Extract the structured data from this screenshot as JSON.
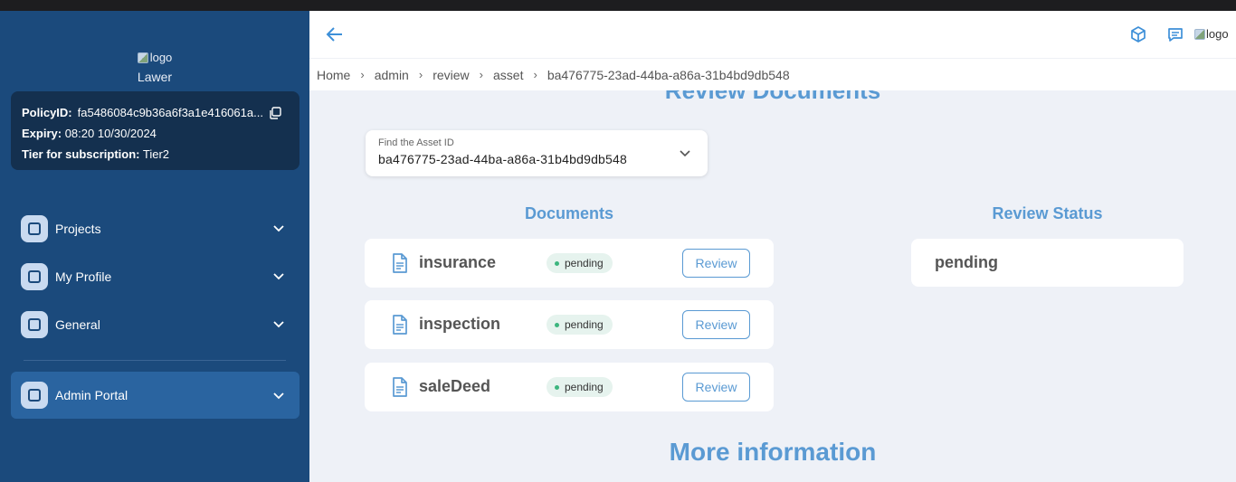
{
  "sidebar": {
    "logo_alt": "logo",
    "brand": "Lawer",
    "policy": {
      "policy_id_label": "PolicyID:",
      "policy_id_value": "fa5486084c9b36a6f3a1e416061a...",
      "expiry_label": "Expiry:",
      "expiry_value": "08:20 10/30/2024",
      "tier_label": "Tier for subscription:",
      "tier_value": "Tier2"
    },
    "items": [
      {
        "label": "Projects"
      },
      {
        "label": "My Profile"
      },
      {
        "label": "General"
      },
      {
        "label": "Admin Portal"
      }
    ]
  },
  "header": {
    "logo_alt": "logo",
    "icons": [
      "back-arrow-icon",
      "cube-icon",
      "chat-icon"
    ]
  },
  "breadcrumb": [
    "Home",
    "admin",
    "review",
    "asset",
    "ba476775-23ad-44ba-a86a-31b4bd9db548"
  ],
  "main": {
    "title": "Review Documents",
    "asset_select": {
      "label": "Find the Asset ID",
      "value": "ba476775-23ad-44ba-a86a-31b4bd9db548"
    },
    "documents_heading": "Documents",
    "review_status_heading": "Review Status",
    "documents": [
      {
        "name": "insurance",
        "status": "pending",
        "action": "Review"
      },
      {
        "name": "inspection",
        "status": "pending",
        "action": "Review"
      },
      {
        "name": "saleDeed",
        "status": "pending",
        "action": "Review"
      }
    ],
    "review_status_value": "pending",
    "more_info_heading": "More information"
  },
  "colors": {
    "sidebar_bg": "#1b4a7c",
    "accent": "#5a9ad3",
    "pending_dot": "#3cb57e"
  }
}
